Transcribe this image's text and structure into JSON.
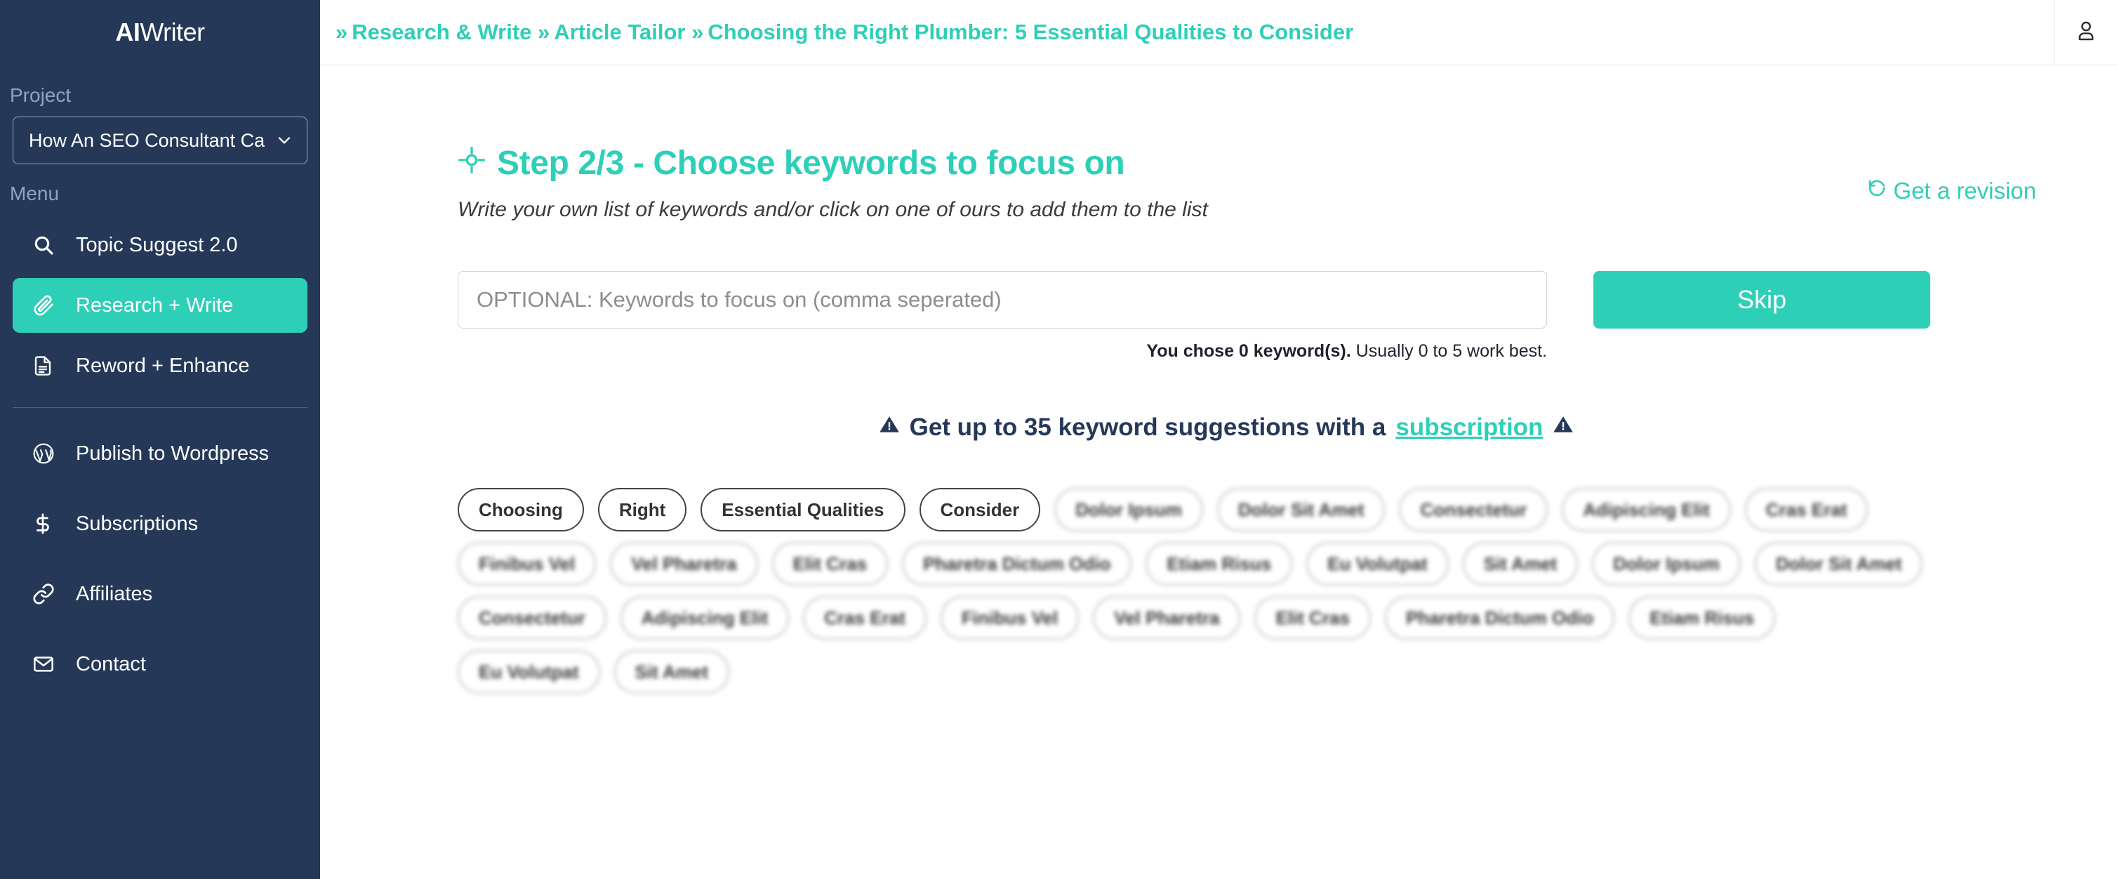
{
  "brand": {
    "bold": "AI",
    "light": "Writer"
  },
  "sidebar": {
    "project_label": "Project",
    "project_value": "How An SEO Consultant Ca",
    "menu_label": "Menu",
    "group1": [
      {
        "label": "Topic Suggest 2.0",
        "icon": "search-icon",
        "active": false
      },
      {
        "label": "Research + Write",
        "icon": "paperclip-icon",
        "active": true
      },
      {
        "label": "Reword + Enhance",
        "icon": "document-icon",
        "active": false
      }
    ],
    "group2": [
      {
        "label": "Publish to Wordpress",
        "icon": "wordpress-icon"
      },
      {
        "label": "Subscriptions",
        "icon": "dollar-icon"
      },
      {
        "label": "Affiliates",
        "icon": "link-icon"
      },
      {
        "label": "Contact",
        "icon": "envelope-icon"
      }
    ]
  },
  "topbar": {
    "breadcrumb": [
      "Research & Write",
      "Article Tailor",
      "Choosing the Right Plumber: 5 Essential Qualities to Consider"
    ],
    "separator": "»",
    "account_icon": "user-icon"
  },
  "main": {
    "revision_label": "Get a revision",
    "revision_icon": "undo-icon",
    "step_icon": "crosshair-icon",
    "step_title": "Step 2/3 - Choose keywords to focus on",
    "step_subtitle": "Write your own list of keywords and/or click on one of ours to add them to the list",
    "keyword_input_placeholder": "OPTIONAL: Keywords to focus on (comma seperated)",
    "keyword_input_value": "",
    "skip_label": "Skip",
    "chose_bold": "You chose 0 keyword(s).",
    "chose_rest": " Usually 0 to 5 work best.",
    "promo_prefix": "Get up to 35 keyword suggestions with a",
    "promo_link": "subscription",
    "promo_icon": "warning-icon",
    "chips": [
      {
        "label": "Choosing",
        "locked": false
      },
      {
        "label": "Right",
        "locked": false
      },
      {
        "label": "Essential Qualities",
        "locked": false
      },
      {
        "label": "Consider",
        "locked": false
      },
      {
        "label": "Dolor Ipsum",
        "locked": true
      },
      {
        "label": "Dolor Sit Amet",
        "locked": true
      },
      {
        "label": "Consectetur",
        "locked": true
      },
      {
        "label": "Adipiscing Elit",
        "locked": true
      },
      {
        "label": "Cras Erat",
        "locked": true
      },
      {
        "label": "Finibus Vel",
        "locked": true
      },
      {
        "label": "Vel Pharetra",
        "locked": true
      },
      {
        "label": "Elit Cras",
        "locked": true
      },
      {
        "label": "Pharetra Dictum Odio",
        "locked": true
      },
      {
        "label": "Etiam Risus",
        "locked": true
      },
      {
        "label": "Eu Volutpat",
        "locked": true
      },
      {
        "label": "Sit Amet",
        "locked": true
      },
      {
        "label": "Dolor Ipsum",
        "locked": true
      },
      {
        "label": "Dolor Sit Amet",
        "locked": true
      },
      {
        "label": "Consectetur",
        "locked": true
      },
      {
        "label": "Adipiscing Elit",
        "locked": true
      },
      {
        "label": "Cras Erat",
        "locked": true
      },
      {
        "label": "Finibus Vel",
        "locked": true
      },
      {
        "label": "Vel Pharetra",
        "locked": true
      },
      {
        "label": "Elit Cras",
        "locked": true
      },
      {
        "label": "Pharetra Dictum Odio",
        "locked": true
      },
      {
        "label": "Etiam Risus",
        "locked": true
      },
      {
        "label": "Eu Volutpat",
        "locked": true
      },
      {
        "label": "Sit Amet",
        "locked": true
      }
    ]
  },
  "colors": {
    "sidebar_bg": "#253858",
    "accent": "#2ecfb7",
    "muted_label": "#8ba4c4"
  }
}
